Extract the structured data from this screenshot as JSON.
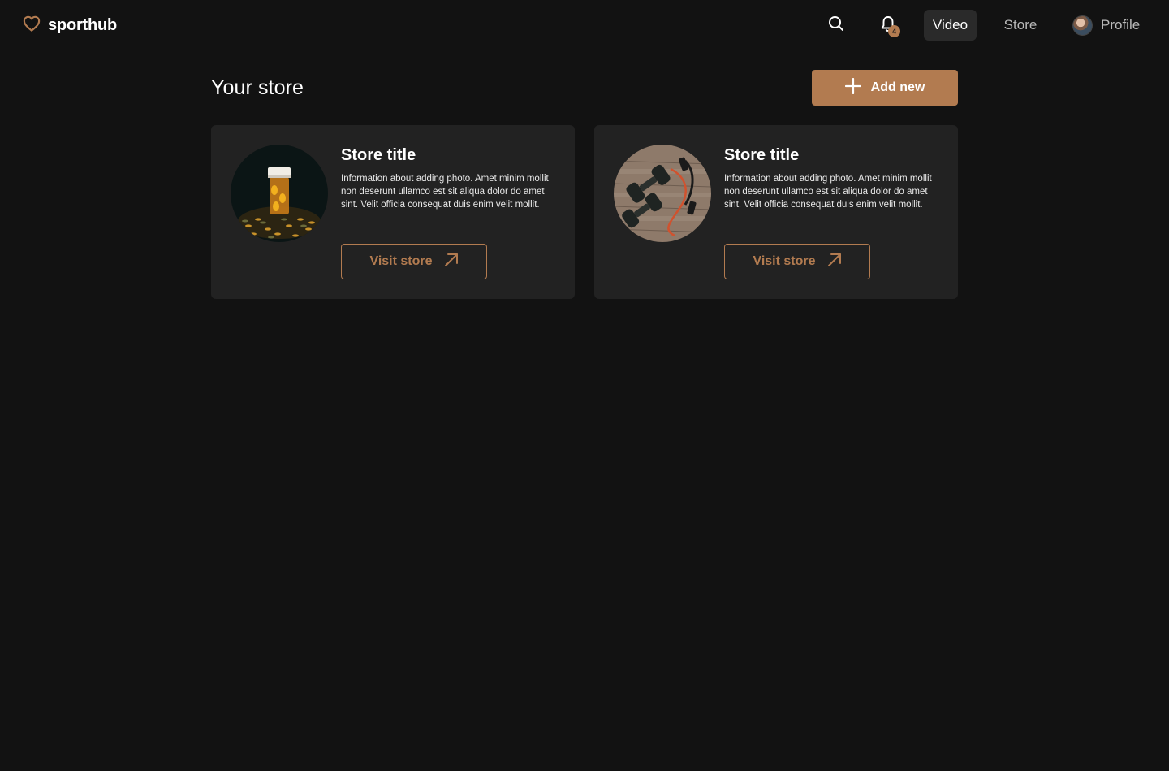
{
  "brand": {
    "name": "sporthub",
    "logo_icon": "heart-icon",
    "accent": "#b27b50"
  },
  "header": {
    "notifications_count": "4",
    "nav": [
      {
        "label": "Video",
        "active": true
      },
      {
        "label": "Store",
        "active": false
      }
    ],
    "profile_label": "Profile"
  },
  "main": {
    "title": "Your store",
    "add_button_label": "Add new",
    "cards": [
      {
        "title": "Store title",
        "description": "Information about adding photo. Amet minim mollit non deserunt ullamco est sit aliqua dolor do amet sint. Velit officia consequat duis enim velit mollit.",
        "button_label": "Visit store",
        "image": "supplement-pills-image"
      },
      {
        "title": "Store title",
        "description": "Information about adding photo. Amet minim mollit non deserunt ullamco est sit aliqua dolor do amet sint. Velit officia consequat duis enim velit mollit.",
        "button_label": "Visit store",
        "image": "dumbbells-jump-rope-image"
      }
    ]
  },
  "colors": {
    "background": "#121212",
    "card": "#222222",
    "accent": "#b27b50",
    "active_tab": "#2a2a2a"
  }
}
